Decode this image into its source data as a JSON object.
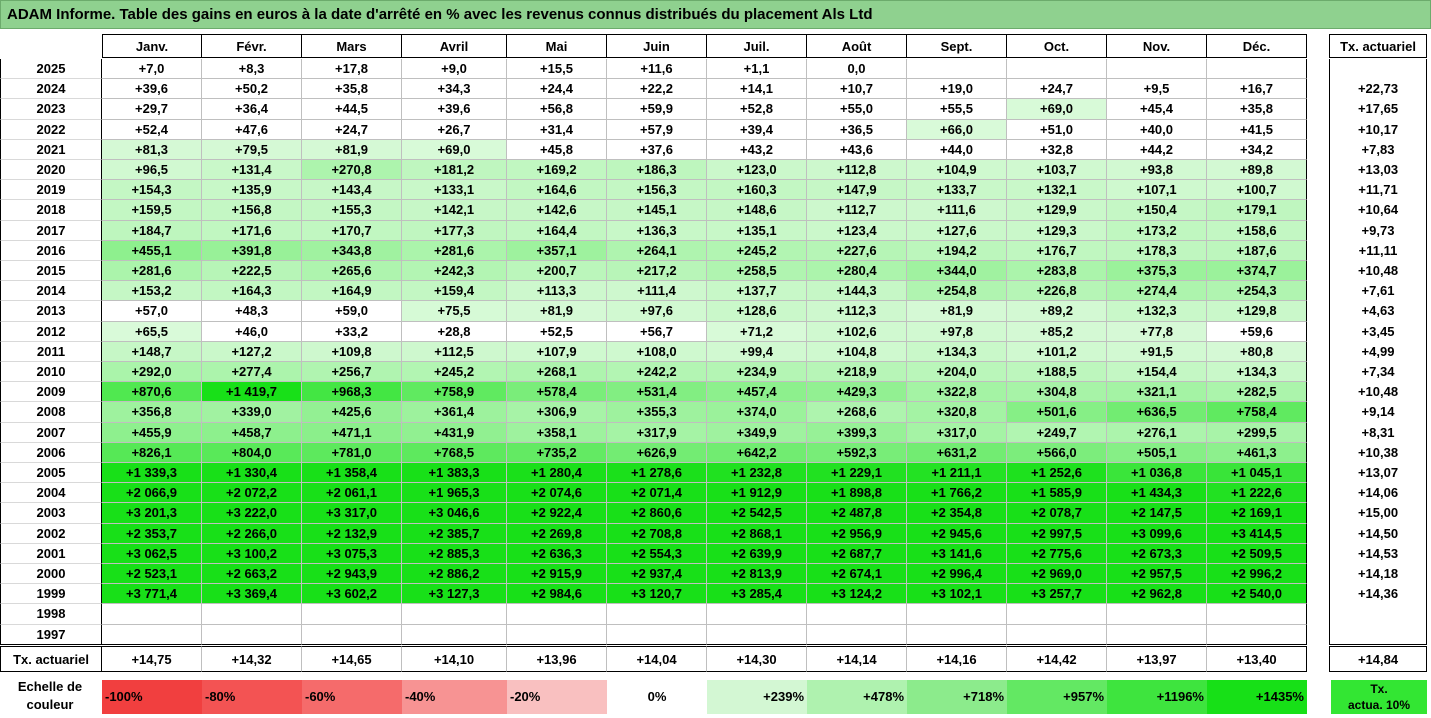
{
  "title": "ADAM Informe. Table des gains en euros à la date d'arrêté en % avec les revenus connus distribués du placement Als Ltd",
  "months": [
    "Janv.",
    "Févr.",
    "Mars",
    "Avril",
    "Mai",
    "Juin",
    "Juil.",
    "Août",
    "Sept.",
    "Oct.",
    "Nov.",
    "Déc."
  ],
  "tx_header": "Tx. actuariel",
  "rows": [
    {
      "year": "2025",
      "values": [
        "+7,0",
        "+8,3",
        "+17,8",
        "+9,0",
        "+15,5",
        "+11,6",
        "+1,1",
        "0,0",
        "",
        "",
        "",
        ""
      ],
      "tx": ""
    },
    {
      "year": "2024",
      "values": [
        "+39,6",
        "+50,2",
        "+35,8",
        "+34,3",
        "+24,4",
        "+22,2",
        "+14,1",
        "+10,7",
        "+19,0",
        "+24,7",
        "+9,5",
        "+16,7"
      ],
      "tx": "+22,73"
    },
    {
      "year": "2023",
      "values": [
        "+29,7",
        "+36,4",
        "+44,5",
        "+39,6",
        "+56,8",
        "+59,9",
        "+52,8",
        "+55,0",
        "+55,5",
        "+69,0",
        "+45,4",
        "+35,8"
      ],
      "tx": "+17,65"
    },
    {
      "year": "2022",
      "values": [
        "+52,4",
        "+47,6",
        "+24,7",
        "+26,7",
        "+31,4",
        "+57,9",
        "+39,4",
        "+36,5",
        "+66,0",
        "+51,0",
        "+40,0",
        "+41,5"
      ],
      "tx": "+10,17"
    },
    {
      "year": "2021",
      "values": [
        "+81,3",
        "+79,5",
        "+81,9",
        "+69,0",
        "+45,8",
        "+37,6",
        "+43,2",
        "+43,6",
        "+44,0",
        "+32,8",
        "+44,2",
        "+34,2"
      ],
      "tx": "+7,83"
    },
    {
      "year": "2020",
      "values": [
        "+96,5",
        "+131,4",
        "+270,8",
        "+181,2",
        "+169,2",
        "+186,3",
        "+123,0",
        "+112,8",
        "+104,9",
        "+103,7",
        "+93,8",
        "+89,8"
      ],
      "tx": "+13,03"
    },
    {
      "year": "2019",
      "values": [
        "+154,3",
        "+135,9",
        "+143,4",
        "+133,1",
        "+164,6",
        "+156,3",
        "+160,3",
        "+147,9",
        "+133,7",
        "+132,1",
        "+107,1",
        "+100,7"
      ],
      "tx": "+11,71"
    },
    {
      "year": "2018",
      "values": [
        "+159,5",
        "+156,8",
        "+155,3",
        "+142,1",
        "+142,6",
        "+145,1",
        "+148,6",
        "+112,7",
        "+111,6",
        "+129,9",
        "+150,4",
        "+179,1"
      ],
      "tx": "+10,64"
    },
    {
      "year": "2017",
      "values": [
        "+184,7",
        "+171,6",
        "+170,7",
        "+177,3",
        "+164,4",
        "+136,3",
        "+135,1",
        "+123,4",
        "+127,6",
        "+129,3",
        "+173,2",
        "+158,6"
      ],
      "tx": "+9,73"
    },
    {
      "year": "2016",
      "values": [
        "+455,1",
        "+391,8",
        "+343,8",
        "+281,6",
        "+357,1",
        "+264,1",
        "+245,2",
        "+227,6",
        "+194,2",
        "+176,7",
        "+178,3",
        "+187,6"
      ],
      "tx": "+11,11"
    },
    {
      "year": "2015",
      "values": [
        "+281,6",
        "+222,5",
        "+265,6",
        "+242,3",
        "+200,7",
        "+217,2",
        "+258,5",
        "+280,4",
        "+344,0",
        "+283,8",
        "+375,3",
        "+374,7"
      ],
      "tx": "+10,48"
    },
    {
      "year": "2014",
      "values": [
        "+153,2",
        "+164,3",
        "+164,9",
        "+159,4",
        "+113,3",
        "+111,4",
        "+137,7",
        "+144,3",
        "+254,8",
        "+226,8",
        "+274,4",
        "+254,3"
      ],
      "tx": "+7,61"
    },
    {
      "year": "2013",
      "values": [
        "+57,0",
        "+48,3",
        "+59,0",
        "+75,5",
        "+81,9",
        "+97,6",
        "+128,6",
        "+112,3",
        "+81,9",
        "+89,2",
        "+132,3",
        "+129,8"
      ],
      "tx": "+4,63"
    },
    {
      "year": "2012",
      "values": [
        "+65,5",
        "+46,0",
        "+33,2",
        "+28,8",
        "+52,5",
        "+56,7",
        "+71,2",
        "+102,6",
        "+97,8",
        "+85,2",
        "+77,8",
        "+59,6"
      ],
      "tx": "+3,45"
    },
    {
      "year": "2011",
      "values": [
        "+148,7",
        "+127,2",
        "+109,8",
        "+112,5",
        "+107,9",
        "+108,0",
        "+99,4",
        "+104,8",
        "+134,3",
        "+101,2",
        "+91,5",
        "+80,8"
      ],
      "tx": "+4,99"
    },
    {
      "year": "2010",
      "values": [
        "+292,0",
        "+277,4",
        "+256,7",
        "+245,2",
        "+268,1",
        "+242,2",
        "+234,9",
        "+218,9",
        "+204,0",
        "+188,5",
        "+154,4",
        "+134,3"
      ],
      "tx": "+7,34"
    },
    {
      "year": "2009",
      "values": [
        "+870,6",
        "+1 419,7",
        "+968,3",
        "+758,9",
        "+578,4",
        "+531,4",
        "+457,4",
        "+429,3",
        "+322,8",
        "+304,8",
        "+321,1",
        "+282,5"
      ],
      "tx": "+10,48"
    },
    {
      "year": "2008",
      "values": [
        "+356,8",
        "+339,0",
        "+425,6",
        "+361,4",
        "+306,9",
        "+355,3",
        "+374,0",
        "+268,6",
        "+320,8",
        "+501,6",
        "+636,5",
        "+758,4"
      ],
      "tx": "+9,14"
    },
    {
      "year": "2007",
      "values": [
        "+455,9",
        "+458,7",
        "+471,1",
        "+431,9",
        "+358,1",
        "+317,9",
        "+349,9",
        "+399,3",
        "+317,0",
        "+249,7",
        "+276,1",
        "+299,5"
      ],
      "tx": "+8,31"
    },
    {
      "year": "2006",
      "values": [
        "+826,1",
        "+804,0",
        "+781,0",
        "+768,5",
        "+735,2",
        "+626,9",
        "+642,2",
        "+592,3",
        "+631,2",
        "+566,0",
        "+505,1",
        "+461,3"
      ],
      "tx": "+10,38"
    },
    {
      "year": "2005",
      "values": [
        "+1 339,3",
        "+1 330,4",
        "+1 358,4",
        "+1 383,3",
        "+1 280,4",
        "+1 278,6",
        "+1 232,8",
        "+1 229,1",
        "+1 211,1",
        "+1 252,6",
        "+1 036,8",
        "+1 045,1"
      ],
      "tx": "+13,07"
    },
    {
      "year": "2004",
      "values": [
        "+2 066,9",
        "+2 072,2",
        "+2 061,1",
        "+1 965,3",
        "+2 074,6",
        "+2 071,4",
        "+1 912,9",
        "+1 898,8",
        "+1 766,2",
        "+1 585,9",
        "+1 434,3",
        "+1 222,6"
      ],
      "tx": "+14,06"
    },
    {
      "year": "2003",
      "values": [
        "+3 201,3",
        "+3 222,0",
        "+3 317,0",
        "+3 046,6",
        "+2 922,4",
        "+2 860,6",
        "+2 542,5",
        "+2 487,8",
        "+2 354,8",
        "+2 078,7",
        "+2 147,5",
        "+2 169,1"
      ],
      "tx": "+15,00"
    },
    {
      "year": "2002",
      "values": [
        "+2 353,7",
        "+2 266,0",
        "+2 132,9",
        "+2 385,7",
        "+2 269,8",
        "+2 708,8",
        "+2 868,1",
        "+2 956,9",
        "+2 945,6",
        "+2 997,5",
        "+3 099,6",
        "+3 414,5"
      ],
      "tx": "+14,50"
    },
    {
      "year": "2001",
      "values": [
        "+3 062,5",
        "+3 100,2",
        "+3 075,3",
        "+2 885,3",
        "+2 636,3",
        "+2 554,3",
        "+2 639,9",
        "+2 687,7",
        "+3 141,6",
        "+2 775,6",
        "+2 673,3",
        "+2 509,5"
      ],
      "tx": "+14,53"
    },
    {
      "year": "2000",
      "values": [
        "+2 523,1",
        "+2 663,2",
        "+2 943,9",
        "+2 886,2",
        "+2 915,9",
        "+2 937,4",
        "+2 813,9",
        "+2 674,1",
        "+2 996,4",
        "+2 969,0",
        "+2 957,5",
        "+2 996,2"
      ],
      "tx": "+14,18"
    },
    {
      "year": "1999",
      "values": [
        "+3 771,4",
        "+3 369,4",
        "+3 602,2",
        "+3 127,3",
        "+2 984,6",
        "+3 120,7",
        "+3 285,4",
        "+3 124,2",
        "+3 102,1",
        "+3 257,7",
        "+2 962,8",
        "+2 540,0"
      ],
      "tx": "+14,36"
    },
    {
      "year": "1998",
      "values": [
        "",
        "",
        "",
        "",
        "",
        "",
        "",
        "",
        "",
        "",
        "",
        ""
      ],
      "tx": ""
    },
    {
      "year": "1997",
      "values": [
        "",
        "",
        "",
        "",
        "",
        "",
        "",
        "",
        "",
        "",
        "",
        ""
      ],
      "tx": ""
    }
  ],
  "summary": {
    "label": "Tx. actuariel",
    "values": [
      "+14,75",
      "+14,32",
      "+14,65",
      "+14,10",
      "+13,96",
      "+14,04",
      "+14,30",
      "+14,14",
      "+14,16",
      "+14,42",
      "+13,97",
      "+13,40"
    ],
    "tx": "+14,84"
  },
  "color_scale": {
    "label": "Echelle de\ncouleur",
    "items": [
      {
        "text": "-100%",
        "color": "#f13f3f",
        "align": "left"
      },
      {
        "text": "-80%",
        "color": "#f35353",
        "align": "left"
      },
      {
        "text": "-60%",
        "color": "#f56b6b",
        "align": "left"
      },
      {
        "text": "-40%",
        "color": "#f79393",
        "align": "left"
      },
      {
        "text": "-20%",
        "color": "#f9c0c0",
        "align": "left"
      },
      {
        "text": "0%",
        "color": "#ffffff",
        "align": "center"
      },
      {
        "text": "+239%",
        "color": "#d3f7d3",
        "align": "right"
      },
      {
        "text": "+478%",
        "color": "#aff2af",
        "align": "right"
      },
      {
        "text": "+718%",
        "color": "#8ceb8c",
        "align": "right"
      },
      {
        "text": "+957%",
        "color": "#63e863",
        "align": "right"
      },
      {
        "text": "+1196%",
        "color": "#3ee43e",
        "align": "right"
      },
      {
        "text": "+1435%",
        "color": "#17e017",
        "align": "right"
      }
    ],
    "tx_legend": "Tx.\nactua. 10%"
  },
  "colors": {
    "title_bg": "#8fd18f",
    "grid_line": "#bfbfbf",
    "border": "#000000"
  }
}
